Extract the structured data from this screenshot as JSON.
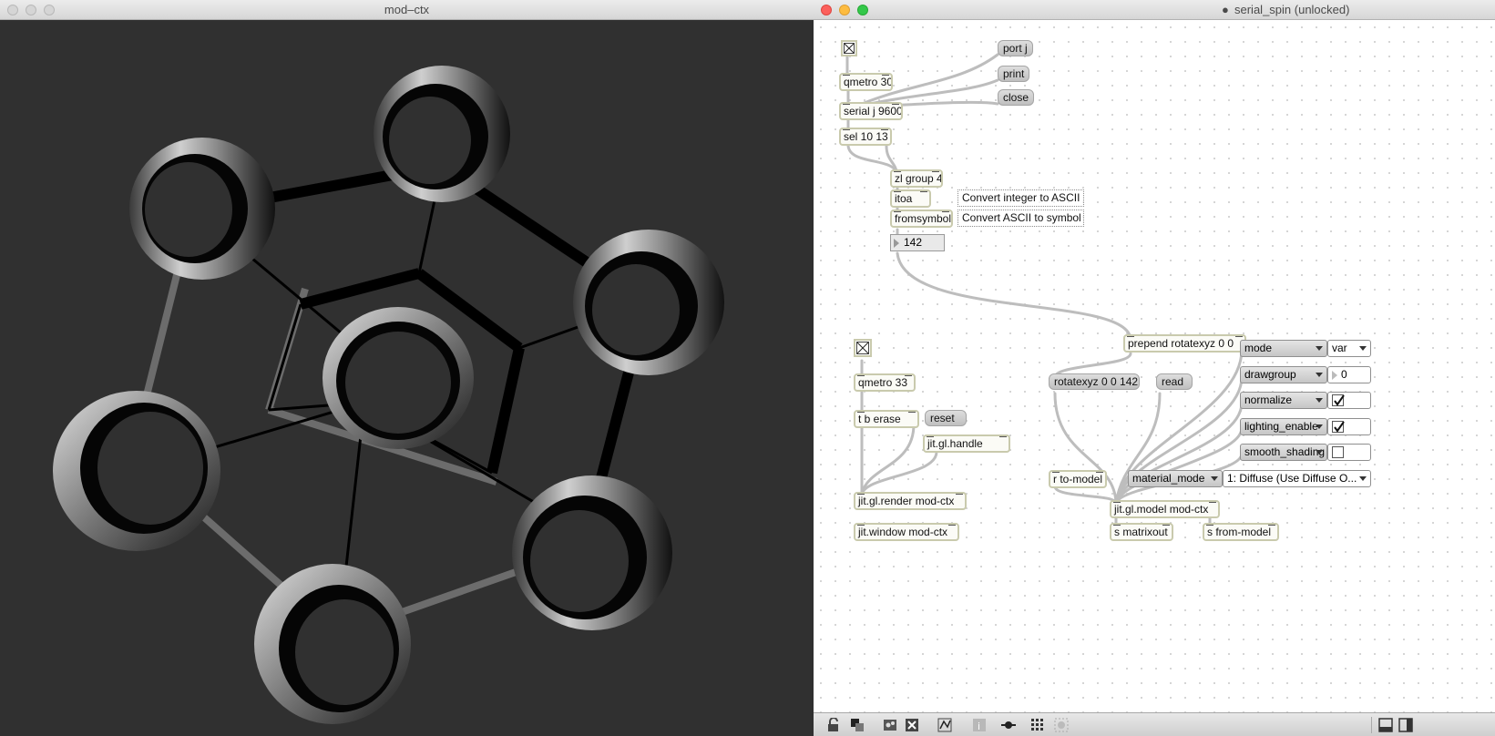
{
  "left_window": {
    "title": "mod–ctx"
  },
  "right_window": {
    "title": "serial_spin (unlocked)"
  },
  "patch": {
    "objects": {
      "qmetro30": "qmetro 30",
      "serial": "serial j 9600",
      "sel": "sel 10 13",
      "zlgroup": "zl group 4",
      "itoa": "itoa",
      "fromsymbol": "fromsymbol",
      "prepend": "prepend rotatexyz 0 0",
      "qmetro33": "qmetro 33",
      "tberase": "t b erase",
      "handle": "jit.gl.handle",
      "render": "jit.gl.render mod-ctx",
      "window": "jit.window mod-ctx",
      "rtomodel": "r to-model",
      "model": "jit.gl.model mod-ctx",
      "smatrixout": "s matrixout",
      "sfrommodel": "s from-model"
    },
    "messages": {
      "portj": "port j",
      "print": "print",
      "close": "close",
      "rotatexyz": "rotatexyz 0 0 142",
      "read": "read",
      "reset": "reset"
    },
    "comments": {
      "itoa": "Convert integer to ASCII",
      "fromsymbol": "Convert ASCII to symbol"
    },
    "number_box": "142",
    "attrui": {
      "mode_label": "mode",
      "mode_value": "var",
      "drawgroup_label": "drawgroup",
      "drawgroup_value": "0",
      "normalize_label": "normalize",
      "lighting_label": "lighting_enable",
      "smooth_label": "smooth_shading",
      "material_label": "material_mode",
      "material_value": "1: Diffuse (Use Diffuse O..."
    }
  },
  "colors": {
    "render_background": "#303030",
    "object_border": "#c9caad",
    "patch_cord": "#bdbdbd"
  }
}
